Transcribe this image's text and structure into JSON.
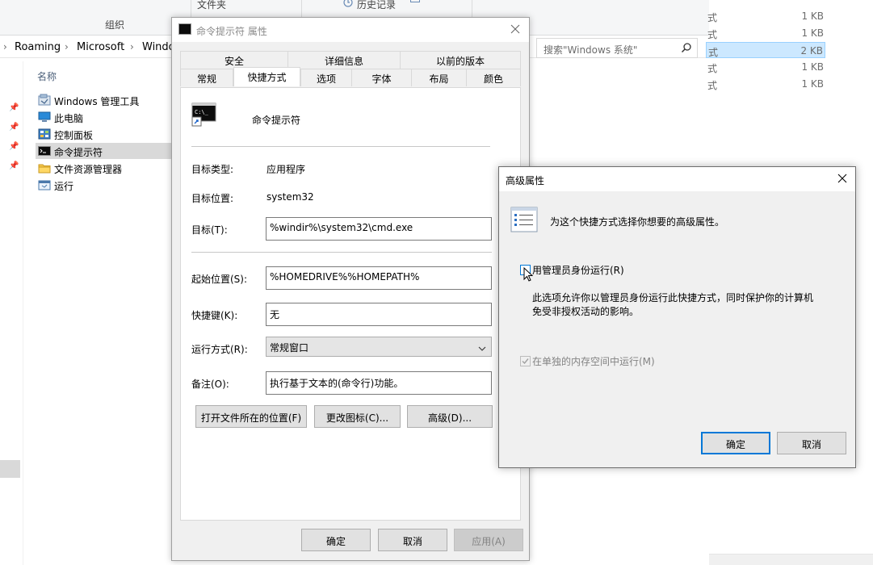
{
  "explorer": {
    "ribbon": {
      "group_label": "组织",
      "top_items": [
        "文件夹",
        "历史记录"
      ]
    },
    "breadcrumb": [
      "Roaming",
      "Microsoft",
      "Windo"
    ],
    "search_placeholder": "搜索\"Windows 系统\"",
    "nav": {
      "header": "名称",
      "items": [
        {
          "label": "Windows 管理工具",
          "icon": "admin-tools-icon"
        },
        {
          "label": "此电脑",
          "icon": "computer-icon"
        },
        {
          "label": "控制面板",
          "icon": "control-panel-icon"
        },
        {
          "label": "命令提示符",
          "icon": "cmd-icon",
          "selected": true
        },
        {
          "label": "文件资源管理器",
          "icon": "folder-icon"
        },
        {
          "label": "运行",
          "icon": "run-icon"
        }
      ]
    },
    "files": [
      {
        "type": "式",
        "size": "1 KB"
      },
      {
        "type": "式",
        "size": "1 KB"
      },
      {
        "type": "式",
        "size": "2 KB",
        "selected": true
      },
      {
        "type": "式",
        "size": "1 KB"
      },
      {
        "type": "式",
        "size": "1 KB"
      }
    ]
  },
  "props": {
    "title": "命令提示符 属性",
    "tabs_top": [
      "安全",
      "详细信息",
      "以前的版本"
    ],
    "tabs_bottom": [
      "常规",
      "快捷方式",
      "选项",
      "字体",
      "布局",
      "颜色"
    ],
    "active_tab": "快捷方式",
    "shortcut_name": "命令提示符",
    "target_type_label": "目标类型:",
    "target_type_value": "应用程序",
    "target_location_label": "目标位置:",
    "target_location_value": "system32",
    "target_label": "目标(T):",
    "target_value": "%windir%\\system32\\cmd.exe",
    "start_in_label": "起始位置(S):",
    "start_in_value": "%HOMEDRIVE%%HOMEPATH%",
    "hotkey_label": "快捷键(K):",
    "hotkey_value": "无",
    "run_label": "运行方式(R):",
    "run_value": "常规窗口",
    "comment_label": "备注(O):",
    "comment_value": "执行基于文本的(命令行)功能。",
    "btn_open_location": "打开文件所在的位置(F)",
    "btn_change_icon": "更改图标(C)...",
    "btn_advanced": "高级(D)...",
    "btn_ok": "确定",
    "btn_cancel": "取消",
    "btn_apply": "应用(A)"
  },
  "advanced": {
    "title": "高级属性",
    "header_text": "为这个快捷方式选择你想要的高级属性。",
    "run_as_admin_label": "用管理员身份运行(R)",
    "run_as_admin_checked": false,
    "description_line1": "此选项允许你以管理员身份运行此快捷方式，同时保护你的计算机",
    "description_line2": "免受非授权活动的影响。",
    "separate_memory_label": "在单独的内存空间中运行(M)",
    "separate_memory_checked": true,
    "separate_memory_disabled": true,
    "btn_ok": "确定",
    "btn_cancel": "取消"
  },
  "colors": {
    "accent": "#0078d7",
    "selection": "#cce8ff",
    "nav_selected": "#d9d9d9"
  }
}
